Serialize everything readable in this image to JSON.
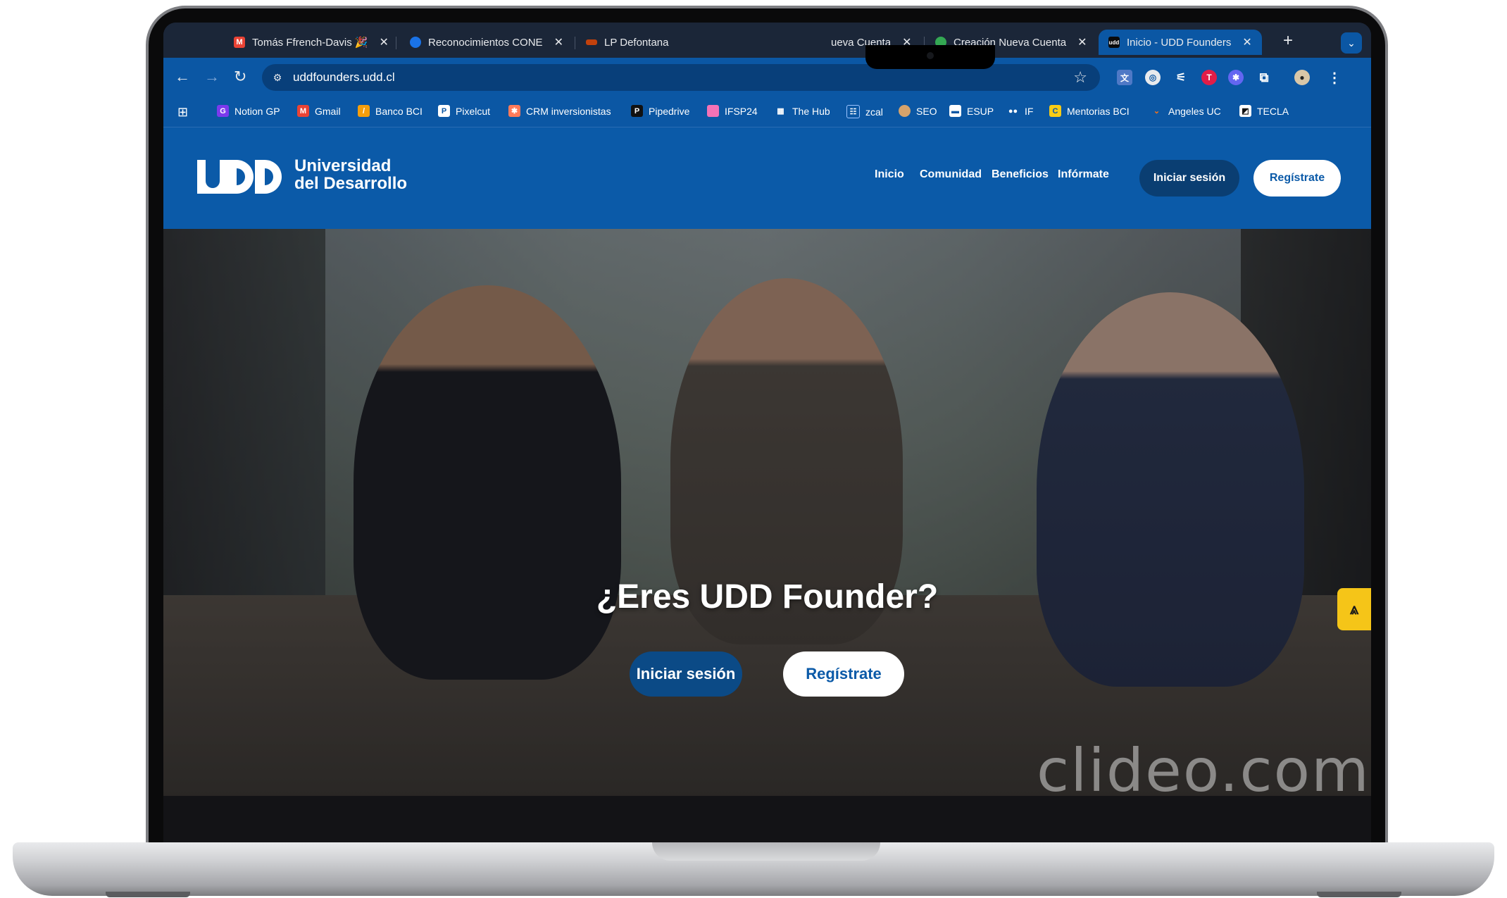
{
  "browser": {
    "tabs": [
      {
        "label": "Tomás Ffrench-Davis 🎉",
        "icon": "gmail-icon"
      },
      {
        "label": "Reconocimientos CONE",
        "icon": "globe-icon"
      },
      {
        "label": "LP Defontana",
        "icon": "defontana-icon"
      },
      {
        "label": "ueva Cuenta",
        "icon": "page-icon"
      },
      {
        "label": "Creación Nueva Cuenta",
        "icon": "globe-icon"
      },
      {
        "label": "Inicio - UDD Founders",
        "icon": "udd-icon"
      }
    ],
    "active_tab": 5,
    "url": "uddfounders.udd.cl",
    "bookmarks": [
      {
        "label": "Notion GP"
      },
      {
        "label": "Gmail"
      },
      {
        "label": "Banco BCI"
      },
      {
        "label": "Pixelcut"
      },
      {
        "label": "CRM inversionistas"
      },
      {
        "label": "Pipedrive"
      },
      {
        "label": "IFSP24"
      },
      {
        "label": "The Hub"
      },
      {
        "label": "zcal"
      },
      {
        "label": "SEO"
      },
      {
        "label": "ESUP"
      },
      {
        "label": "IF"
      },
      {
        "label": "Mentorias BCI"
      },
      {
        "label": "Angeles UC"
      },
      {
        "label": "TECLA"
      }
    ]
  },
  "site": {
    "logo_line1": "Universidad",
    "logo_line2": "del Desarrollo",
    "nav": [
      "Inicio",
      "Comunidad",
      "Beneficios",
      "Infórmate"
    ],
    "login_label": "Iniciar sesión",
    "register_label": "Regístrate"
  },
  "hero": {
    "title": "¿Eres UDD Founder?",
    "login_label": "Iniciar sesión",
    "register_label": "Regístrate",
    "watermark": "clideo.com"
  },
  "colors": {
    "brand_blue": "#0b5aa8",
    "dark_blue": "#0a3e72",
    "badge_yellow": "#f5c518"
  }
}
